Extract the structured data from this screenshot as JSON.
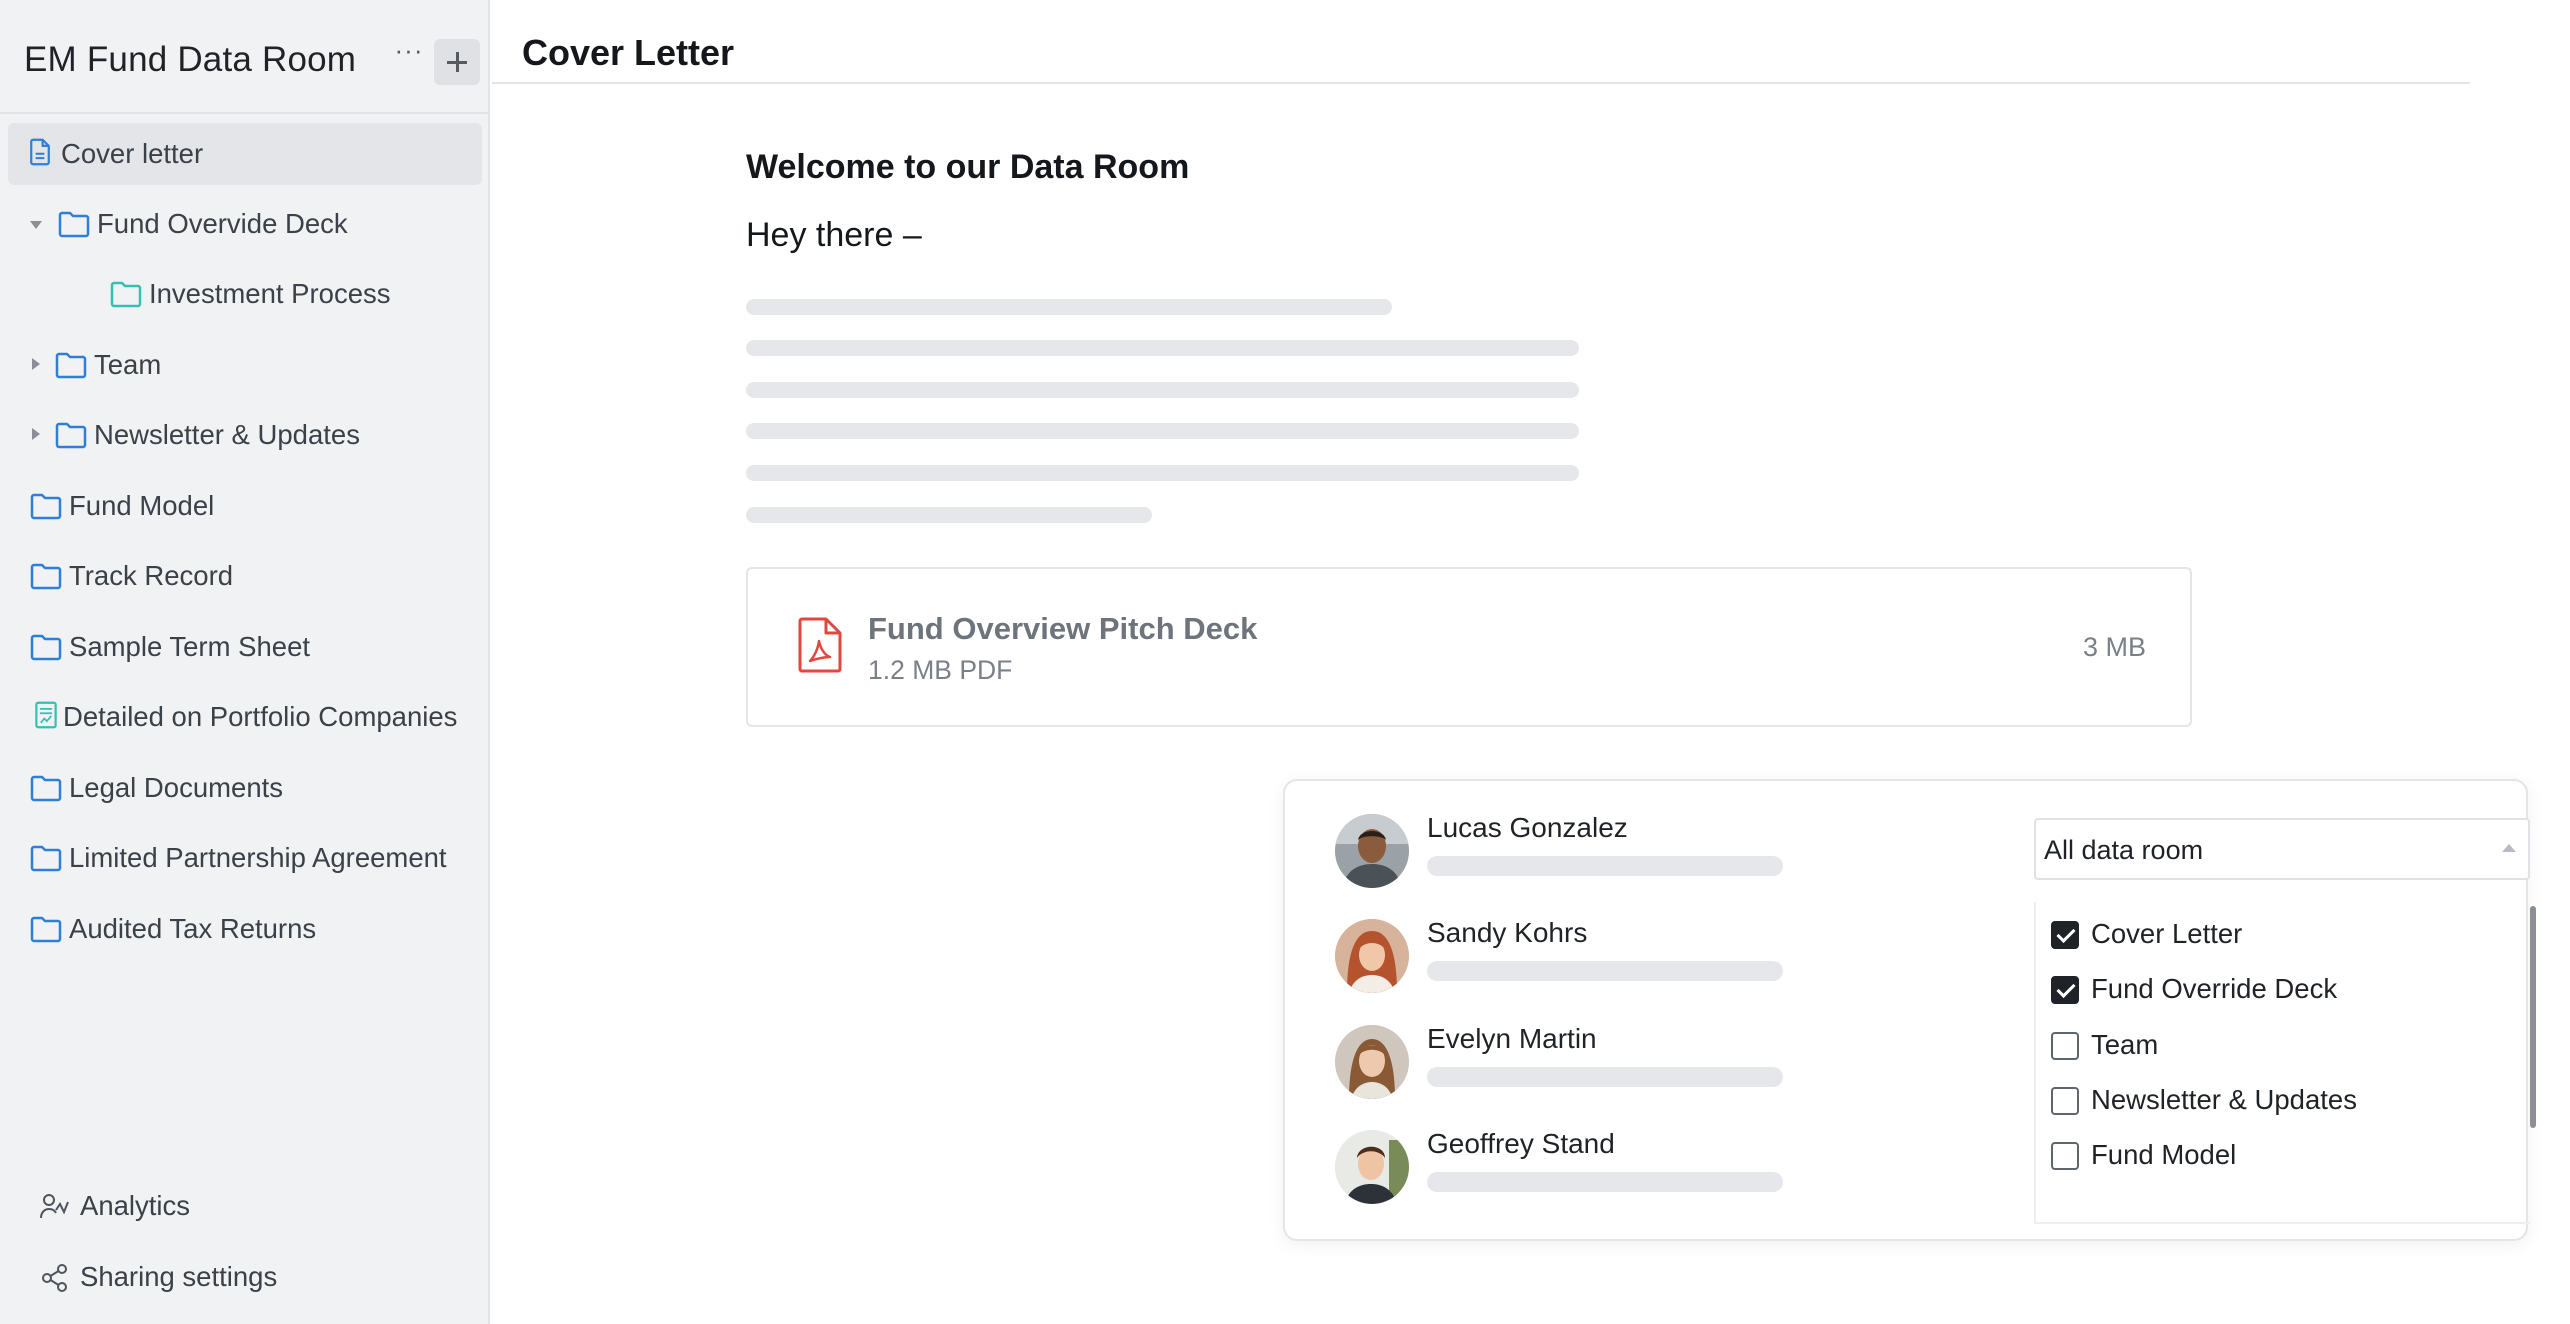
{
  "sidebar": {
    "title": "EM Fund Data Room",
    "more_label": "···",
    "items": [
      {
        "label": "Cover letter"
      },
      {
        "label": "Fund Overvide Deck"
      },
      {
        "label": "Investment Process"
      },
      {
        "label": "Team"
      },
      {
        "label": "Newsletter & Updates"
      },
      {
        "label": "Fund Model"
      },
      {
        "label": "Track Record"
      },
      {
        "label": "Sample Term Sheet"
      },
      {
        "label": "Detailed on Portfolio Companies"
      },
      {
        "label": "Legal Documents"
      },
      {
        "label": "Limited Partnership Agreement"
      },
      {
        "label": "Audited Tax Returns"
      }
    ],
    "footer": {
      "analytics": "Analytics",
      "sharing": "Sharing settings"
    }
  },
  "main": {
    "title": "Cover Letter",
    "heading": "Welcome to our Data Room",
    "greeting": "Hey there –",
    "file": {
      "name": "Fund Overview Pitch Deck",
      "meta": "1.2 MB PDF",
      "size": "3 MB"
    }
  },
  "share": {
    "people": [
      {
        "name": "Lucas Gonzalez"
      },
      {
        "name": "Sandy Kohrs"
      },
      {
        "name": "Evelyn Martin"
      },
      {
        "name": "Geoffrey Stand"
      }
    ],
    "scope": "All data room",
    "options": [
      {
        "label": "Cover Letter",
        "checked": true
      },
      {
        "label": "Fund Override Deck",
        "checked": true
      },
      {
        "label": "Team",
        "checked": false
      },
      {
        "label": "Newsletter & Updates",
        "checked": false
      },
      {
        "label": "Fund Model",
        "checked": false
      }
    ]
  },
  "colors": {
    "folder_blue": "#2f7fd6",
    "folder_teal": "#35bfb0",
    "pdf_red": "#e0473f",
    "sidebar_bg": "#f1f2f4"
  }
}
